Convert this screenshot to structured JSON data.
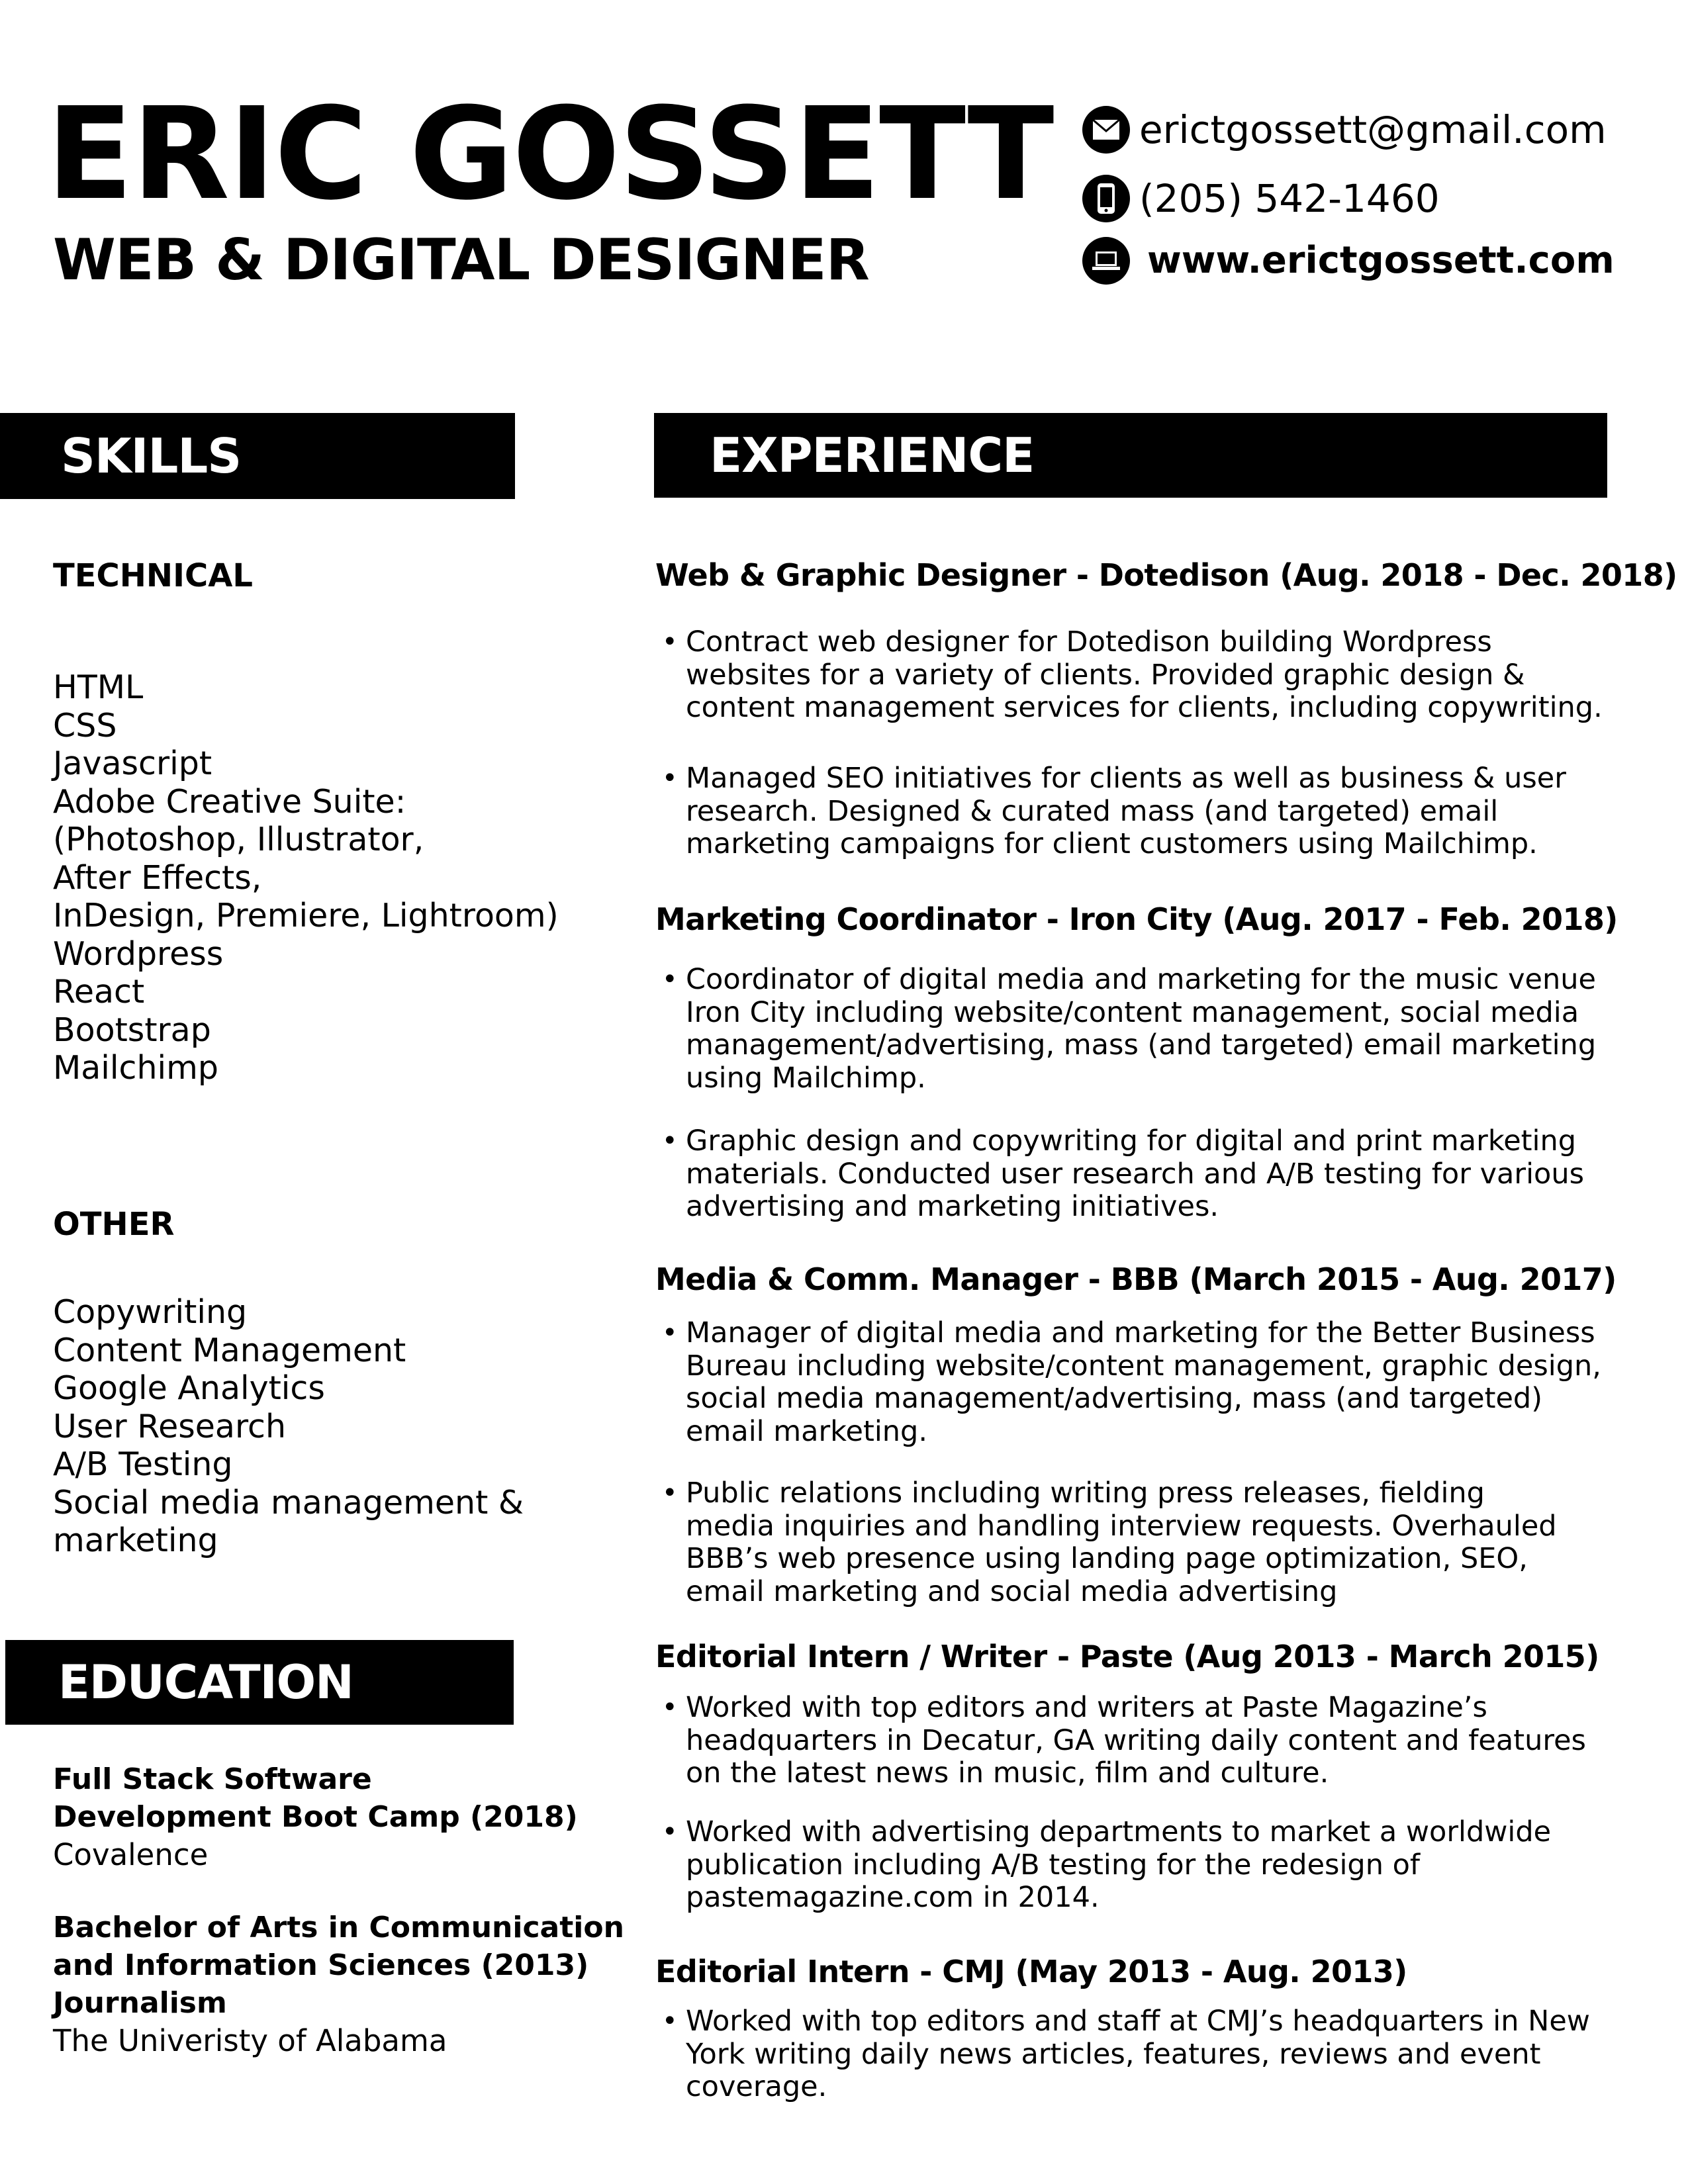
{
  "header": {
    "name": "ERIC GOSSETT",
    "title": "WEB & DIGITAL DESIGNER"
  },
  "contact": {
    "email": "erictgossett@gmail.com",
    "phone": "(205) 542-1460",
    "website": "www.erictgossett.com",
    "email_icon": "envelope-icon",
    "phone_icon": "phone-icon",
    "website_icon": "laptop-icon"
  },
  "skills": {
    "heading": "SKILLS",
    "technical_heading": "TECHNICAL",
    "technical": [
      "HTML",
      "CSS",
      "Javascript",
      "Adobe Creative Suite:",
      "(Photoshop, Illustrator,",
      "After Effects,",
      "InDesign, Premiere, Lightroom)",
      "Wordpress",
      "React",
      "Bootstrap",
      "Mailchimp"
    ],
    "other_heading": "OTHER",
    "other": [
      "Copywriting",
      "Content Management",
      "Google Analytics",
      "User Research",
      "A/B Testing",
      "Social media management &",
      "marketing"
    ]
  },
  "education": {
    "heading": "EDUCATION",
    "entries": [
      {
        "degree_lines": [
          "Full Stack Software",
          "Development Boot Camp (2018)"
        ],
        "school": "Covalence"
      },
      {
        "degree_lines": [
          "Bachelor of Arts in Communication",
          "and Information Sciences (2013)",
          "Journalism"
        ],
        "school": "The Univeristy of Alabama"
      }
    ]
  },
  "experience": {
    "heading": "EXPERIENCE",
    "jobs": [
      {
        "title": "Web & Graphic Designer - Dotedison (Aug. 2018 - Dec. 2018)",
        "bullets": [
          [
            "Contract web designer for Dotedison building Wordpress",
            "websites for a variety of clients. Provided graphic design &",
            "content management services for clients, including copywriting."
          ],
          [
            "Managed SEO initiatives for clients as well as business & user",
            "research. Designed & curated mass (and targeted) email",
            "marketing campaigns for client customers using Mailchimp."
          ]
        ]
      },
      {
        "title": "Marketing Coordinator - Iron City (Aug. 2017 - Feb. 2018)",
        "bullets": [
          [
            "Coordinator of digital media and marketing for the music venue",
            "Iron City including website/content management, social media",
            "management/advertising, mass (and targeted) email marketing",
            "using Mailchimp."
          ],
          [
            "Graphic design and copywriting for digital and print marketing",
            "materials. Conducted user research and A/B testing for various",
            "advertising and marketing initiatives."
          ]
        ]
      },
      {
        "title": "Media & Comm. Manager - BBB (March 2015 - Aug. 2017)",
        "bullets": [
          [
            "Manager of digital media and marketing for the Better Business",
            "Bureau including website/content management, graphic design,",
            "social media management/advertising, mass (and targeted)",
            "email marketing."
          ],
          [
            "Public relations including writing press releases, fielding",
            "media inquiries and handling interview requests. Overhauled",
            "BBB’s web presence using landing page optimization, SEO,",
            "email marketing and social media advertising"
          ]
        ]
      },
      {
        "title": "Editorial Intern / Writer - Paste (Aug 2013 - March 2015)",
        "bullets": [
          [
            "Worked with top editors and writers at Paste Magazine’s",
            "headquarters in Decatur, GA writing daily content and features",
            "on the latest news in music, film and culture."
          ],
          [
            "Worked with advertising departments to market a worldwide",
            "publication including A/B testing for the redesign of",
            "pastemagazine.com in 2014."
          ]
        ]
      },
      {
        "title": "Editorial Intern - CMJ (May 2013 - Aug. 2013)",
        "bullets": [
          [
            "Worked with top editors and staff at CMJ’s headquarters in New",
            "York writing daily news articles, features, reviews and event",
            "coverage."
          ]
        ]
      }
    ]
  }
}
